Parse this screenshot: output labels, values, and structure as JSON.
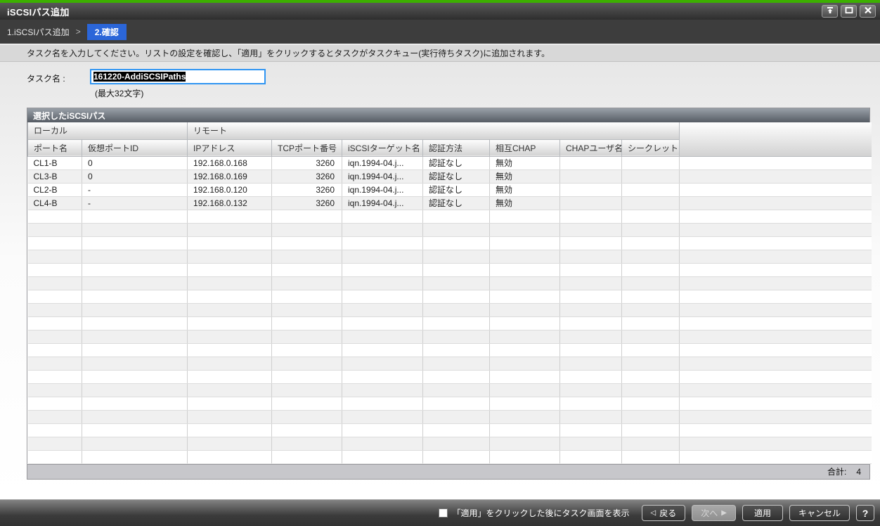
{
  "window": {
    "title": "iSCSIパス追加"
  },
  "breadcrumb": {
    "step1": "1.iSCSIパス追加",
    "separator": ">",
    "step2": "2.確認"
  },
  "instruction": "タスク名を入力してください。リストの設定を確認し、「適用」をクリックするとタスクがタスクキュー(実行待ちタスク)に追加されます。",
  "task": {
    "label": "タスク名 :",
    "value": "161220-AddiSCSIPaths",
    "hint": "(最大32文字)"
  },
  "table": {
    "title": "選択したiSCSIパス",
    "group_headers": {
      "local": "ローカル",
      "remote": "リモート"
    },
    "columns": [
      "ポート名",
      "仮想ポートID",
      "IPアドレス",
      "TCPポート番号",
      "iSCSIターゲット名",
      "認証方法",
      "相互CHAP",
      "CHAPユーザ名",
      "シークレット"
    ],
    "rows": [
      [
        "CL1-B",
        "0",
        "192.168.0.168",
        "3260",
        "iqn.1994-04.j...",
        "認証なし",
        "無効",
        "",
        ""
      ],
      [
        "CL3-B",
        "0",
        "192.168.0.169",
        "3260",
        "iqn.1994-04.j...",
        "認証なし",
        "無効",
        "",
        ""
      ],
      [
        "CL2-B",
        "-",
        "192.168.0.120",
        "3260",
        "iqn.1994-04.j...",
        "認証なし",
        "無効",
        "",
        ""
      ],
      [
        "CL4-B",
        "-",
        "192.168.0.132",
        "3260",
        "iqn.1994-04.j...",
        "認証なし",
        "無効",
        "",
        ""
      ]
    ],
    "empty_row_count": 19,
    "footer": {
      "total_label": "合計:",
      "total_value": "4"
    }
  },
  "bottom_bar": {
    "checkbox_label": "「適用」をクリックした後にタスク画面を表示",
    "checkbox_checked": false,
    "back_label": "戻る",
    "next_label": "次へ",
    "apply_label": "適用",
    "cancel_label": "キャンセル",
    "help_label": "?"
  },
  "icons": {
    "back_arrow": "◁",
    "next_arrow": "▶"
  },
  "colors": {
    "accent_green": "#3cb000",
    "active_step_blue": "#2b66d9",
    "input_focus_border": "#2f95f2",
    "selection_bg": "#000000",
    "titlebar_dark": "#2e2e2e"
  }
}
